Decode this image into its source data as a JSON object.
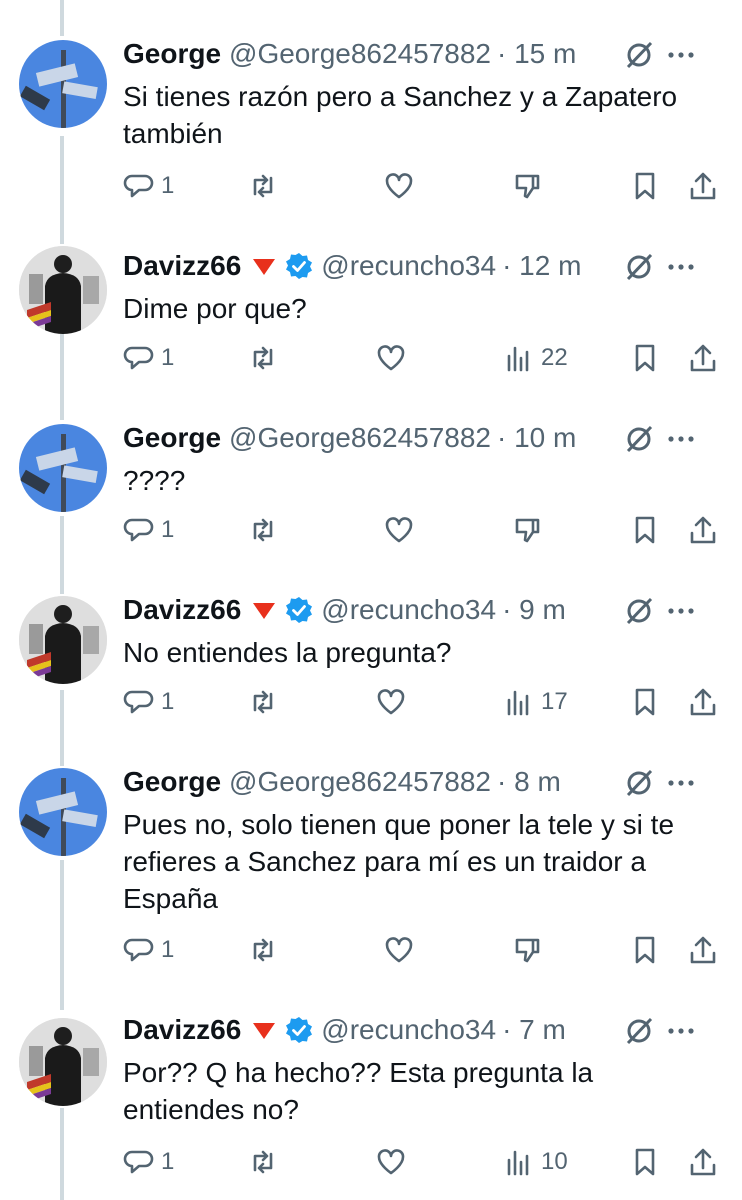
{
  "tweets": [
    {
      "author": "george",
      "name": "George",
      "handle": "@George862457882",
      "time": "· 15 m",
      "text": "Si tienes razón pero a Sanchez y a Zapatero también",
      "reply_count": "1",
      "views": ""
    },
    {
      "author": "davizz",
      "name": "Davizz66",
      "handle": "@recuncho34",
      "time": "· 12 m",
      "text": "Dime por que?",
      "reply_count": "1",
      "views": "22"
    },
    {
      "author": "george",
      "name": "George",
      "handle": "@George862457882",
      "time": "· 10 m",
      "text": "????",
      "reply_count": "1",
      "views": ""
    },
    {
      "author": "davizz",
      "name": "Davizz66",
      "handle": "@recuncho34",
      "time": "· 9 m",
      "text": "No entiendes la pregunta?",
      "reply_count": "1",
      "views": "17"
    },
    {
      "author": "george",
      "name": "George",
      "handle": "@George862457882",
      "time": "· 8 m",
      "text": "Pues no, solo tienen que poner la tele y si te refieres a Sanchez para mí es un traidor a España",
      "reply_count": "1",
      "views": ""
    },
    {
      "author": "davizz",
      "name": "Davizz66",
      "handle": "@recuncho34",
      "time": "· 7 m",
      "text": "Por?? Q ha hecho?? Esta pregunta la entiendes no?",
      "reply_count": "1",
      "views": "10"
    }
  ],
  "colors": {
    "accent": "#1d9bf0",
    "muted": "#536471",
    "flag": "#e8301c",
    "thread_line": "#cfd9de"
  }
}
